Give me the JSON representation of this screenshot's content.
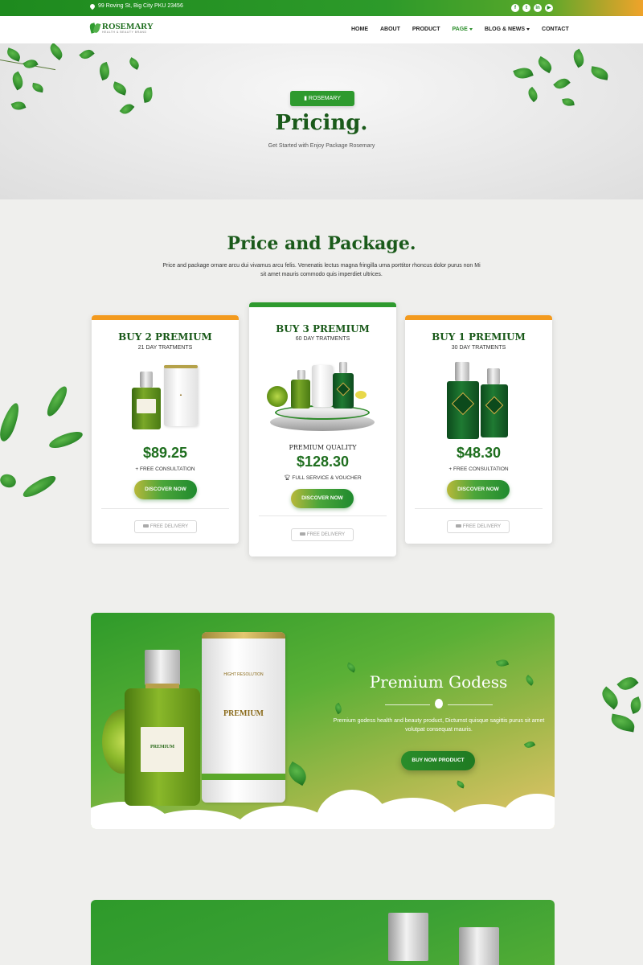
{
  "topbar": {
    "address": "99 Roving St, Big City PKU 23456",
    "socials": [
      "facebook-icon",
      "twitter-icon",
      "linkedin-icon",
      "youtube-icon"
    ]
  },
  "brand": {
    "name": "ROSEMARY",
    "tagline": "HEALTH & BEAUTY BRAND"
  },
  "nav": {
    "items": [
      {
        "label": "HOME"
      },
      {
        "label": "ABOUT"
      },
      {
        "label": "PRODUCT"
      },
      {
        "label": "PAGE",
        "active": true,
        "dropdown": true
      },
      {
        "label": "BLOG & NEWS",
        "dropdown": true
      },
      {
        "label": "CONTACT"
      }
    ]
  },
  "hero": {
    "badge": "ROSEMARY",
    "title": "Pricing.",
    "subtitle": "Get Started with Enjoy Package Rosemary"
  },
  "section": {
    "title": "Price and Package.",
    "description": "Price and package ornare arcu dui vivamus arcu felis. Venenatis lectus magna fringilla urna porttitor rhoncus dolor purus non Mi sit amet mauris commodo quis imperdiet ultrices."
  },
  "plans": [
    {
      "name": "BUY 2 PREMIUM",
      "days": "21 DAY TRATMENTS",
      "price": "$89.25",
      "extra": "FREE CONSULTATION",
      "button": "DISCOVER NOW",
      "delivery": "FREE DELIVERY"
    },
    {
      "name": "BUY 3 PREMIUM",
      "days": "60 DAY TRATMENTS",
      "quality": "PREMIUM QUALITY",
      "price": "$128.30",
      "extra": "FULL SERVICE & VOUCHER",
      "button": "DISCOVER NOW",
      "delivery": "FREE DELIVERY"
    },
    {
      "name": "BUY 1 PREMIUM",
      "days": "30 DAY TRATMENTS",
      "price": "$48.30",
      "extra": "FREE CONSULTATION",
      "button": "DISCOVER NOW",
      "delivery": "FREE DELIVERY"
    }
  ],
  "banner": {
    "title": "Premium Godess",
    "description": "Premium godess health and beauty product, Dictumst quisque sagittis purus sit amet volutpat consequat mauris.",
    "button": "BUY NOW PRODUCT",
    "product_label": "PREMIUM",
    "box_label": "PREMIUM",
    "box_top_text": "HIGHT RESOLUTION"
  },
  "colors": {
    "primary": "#2e9a2e",
    "dark_green": "#1a5a1a",
    "accent_orange": "#f0a32a"
  }
}
